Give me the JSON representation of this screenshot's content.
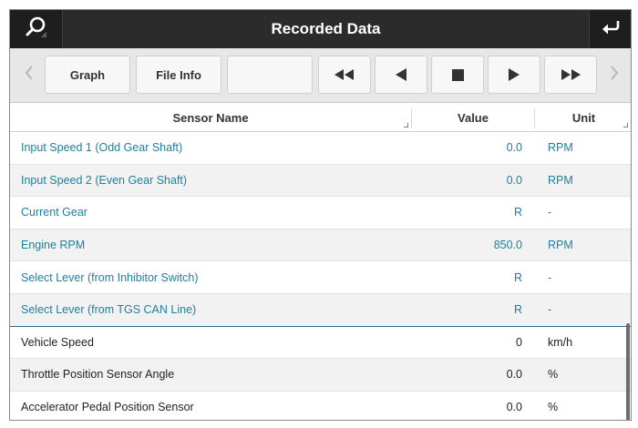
{
  "titlebar": {
    "title": "Recorded Data",
    "left_icon": "search-icon",
    "right_icon": "return-arrow-icon"
  },
  "toolbar": {
    "graph_label": "Graph",
    "file_info_label": "File Info",
    "blank_label": "",
    "buttons": [
      "rewind-icon",
      "step-back-icon",
      "stop-icon",
      "play-icon",
      "fast-forward-icon"
    ],
    "prev_icon": "chevron-left-icon",
    "next_icon": "chevron-right-icon"
  },
  "table": {
    "columns": {
      "name": "Sensor Name",
      "value": "Value",
      "unit": "Unit"
    },
    "rows": [
      {
        "name": "Input Speed 1 (Odd Gear Shaft)",
        "value": "0.0",
        "unit": "RPM"
      },
      {
        "name": "Input Speed 2 (Even Gear Shaft)",
        "value": "0.0",
        "unit": "RPM"
      },
      {
        "name": "Current Gear",
        "value": "R",
        "unit": "-"
      },
      {
        "name": "Engine RPM",
        "value": "850.0",
        "unit": "RPM"
      },
      {
        "name": "Select Lever (from Inhibitor Switch)",
        "value": "R",
        "unit": "-"
      },
      {
        "name": "Select Lever (from TGS CAN Line)",
        "value": "R",
        "unit": "-"
      },
      {
        "name": "Vehicle Speed",
        "value": "0",
        "unit": "km/h"
      },
      {
        "name": "Throttle Position Sensor Angle",
        "value": "0.0",
        "unit": "%"
      },
      {
        "name": "Accelerator Pedal Position Sensor",
        "value": "0.0",
        "unit": "%"
      }
    ]
  },
  "colors": {
    "titlebar_bg": "#2b2b2b",
    "selected_text": "#1f7f9e",
    "toolbar_bg": "#e7e7e7"
  }
}
